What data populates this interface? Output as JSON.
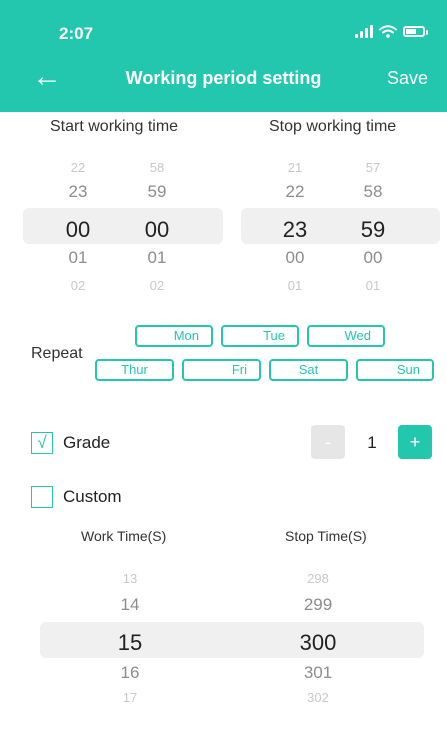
{
  "status_bar": {
    "time": "2:07"
  },
  "nav": {
    "back_icon": "←",
    "title": "Working period setting",
    "save_label": "Save"
  },
  "start_time": {
    "label": "Start working time",
    "hours": [
      "22",
      "23",
      "00",
      "01",
      "02"
    ],
    "minutes": [
      "58",
      "59",
      "00",
      "01",
      "02"
    ]
  },
  "stop_time": {
    "label": "Stop working time",
    "hours": [
      "21",
      "22",
      "23",
      "00",
      "01"
    ],
    "minutes": [
      "57",
      "58",
      "59",
      "00",
      "01"
    ]
  },
  "repeat": {
    "label": "Repeat",
    "days": [
      "Mon",
      "Tue",
      "Wed",
      "Thur",
      "Fri",
      "Sat",
      "Sun"
    ]
  },
  "grade": {
    "checked": true,
    "check_mark": "√",
    "label": "Grade",
    "minus_label": "-",
    "value": "1",
    "plus_label": "+"
  },
  "custom": {
    "checked": false,
    "label": "Custom",
    "work_time_label": "Work Time(S)",
    "stop_time_label": "Stop Time(S)",
    "work_values": [
      "13",
      "14",
      "15",
      "16",
      "17"
    ],
    "stop_values": [
      "298",
      "299",
      "300",
      "301",
      "302"
    ]
  },
  "colors": {
    "accent": "#22c7ad",
    "disabled": "#e6e6e6",
    "band": "#f0f0f0"
  }
}
